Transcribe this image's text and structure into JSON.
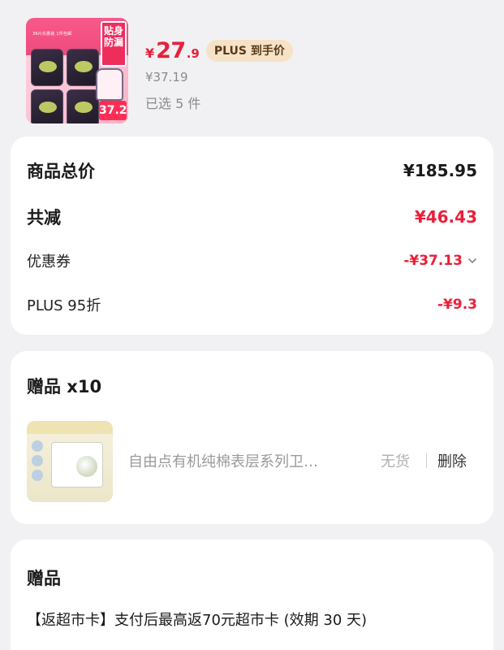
{
  "product": {
    "thumbnail": {
      "tag_text": "贴身防漏",
      "price_chip": "37.2",
      "tiny_text": "36片实惠装 1件包邮"
    },
    "price_yen": "¥",
    "price_int": "27",
    "price_dec": ".9",
    "plus_badge": "PLUS 到手价",
    "original_price": "¥37.19",
    "selected_count": "已选 5 件"
  },
  "summary": {
    "total_label": "商品总价",
    "total_value": "¥185.95",
    "discount_label": "共减",
    "discount_value": "¥46.43",
    "coupon_label": "优惠券",
    "coupon_value": "-¥37.13",
    "plus_label": "PLUS 95折",
    "plus_value": "-¥9.3"
  },
  "gifts": {
    "title": "赠品 x10",
    "item_name": "自由点有机纯棉表层系列卫…",
    "status": "无货",
    "delete_label": "删除"
  },
  "bonus": {
    "title": "赠品",
    "text": "【返超市卡】支付后最高返70元超市卡 (效期 30 天)"
  },
  "colors": {
    "price_red": "#e8203a",
    "plus_badge_bg": "#f6e2c6",
    "page_bg": "#f1f1f3"
  }
}
